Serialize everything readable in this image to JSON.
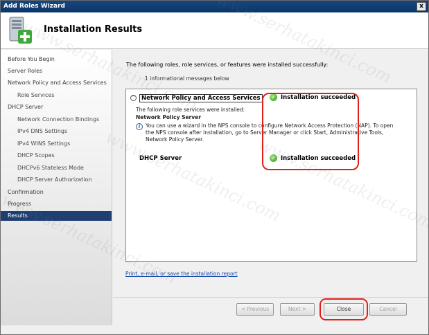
{
  "window": {
    "title": "Add Roles Wizard",
    "close_glyph": "x"
  },
  "header": {
    "title": "Installation Results",
    "icon": "server-roles-icon"
  },
  "nav": {
    "items": [
      {
        "label": "Before You Begin"
      },
      {
        "label": "Server Roles"
      },
      {
        "label": "Network Policy and Access Services"
      },
      {
        "label": "Role Services"
      },
      {
        "label": "DHCP Server"
      },
      {
        "label": "Network Connection Bindings"
      },
      {
        "label": "IPv4 DNS Settings"
      },
      {
        "label": "IPv4 WINS Settings"
      },
      {
        "label": "DHCP Scopes"
      },
      {
        "label": "DHCPv6 Stateless Mode"
      },
      {
        "label": "DHCP Server Authorization"
      },
      {
        "label": "Confirmation"
      },
      {
        "label": "Progress"
      },
      {
        "label": "Results"
      }
    ]
  },
  "main": {
    "intro": "The following roles, role services, or features were installed successfully:",
    "info_count": "1 informational messages below",
    "collapse_glyph": "^",
    "check_glyph": "✓",
    "info_glyph": "i",
    "sections": [
      {
        "title": "Network Policy and Access Services",
        "status": "Installation succeeded",
        "line1": "The following role services were installed:",
        "subhead": "Network Policy Server",
        "info_line1": "You can use a wizard in the NPS console to configure Network Access Protection (NAP). To open",
        "info_line2": "the NPS console after installation, go to Server Manager or click Start, Administrative Tools,",
        "info_line3": "Network Policy Server."
      },
      {
        "title": "DHCP Server",
        "status": "Installation succeeded"
      }
    ],
    "report_link": "Print, e-mail, or save the installation report"
  },
  "buttons": {
    "previous": "< Previous",
    "next": "Next >",
    "close": "Close",
    "cancel": "Cancel"
  },
  "watermark": "www.serhatakinci.com",
  "colors": {
    "title_bar": "#0b3668",
    "selected_nav": "#1f3f73",
    "highlight_ring": "#e0201a",
    "success": "#2f9b1b"
  }
}
